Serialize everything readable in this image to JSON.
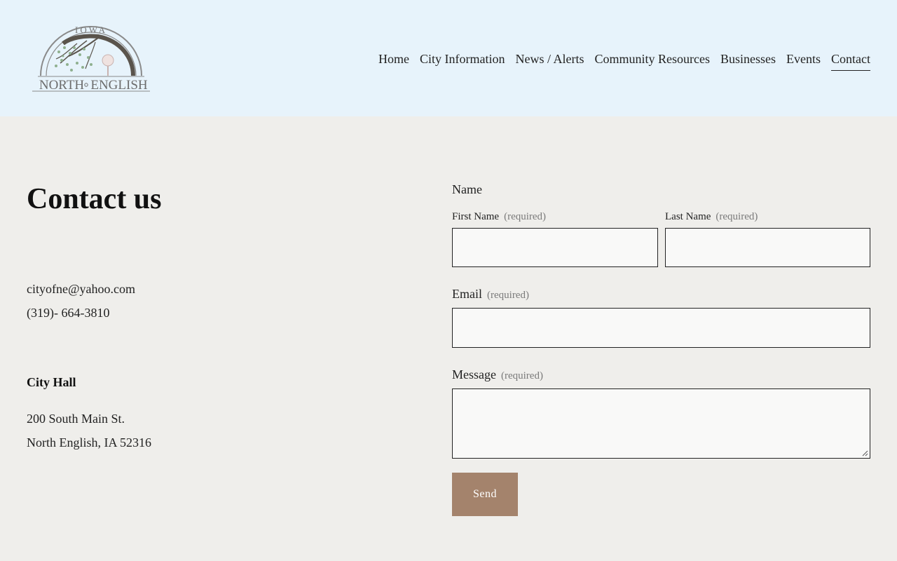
{
  "logo": {
    "top_text": "IOWA",
    "left_text": "NORTH",
    "right_text": "ENGLISH"
  },
  "nav": {
    "items": [
      {
        "label": "Home"
      },
      {
        "label": "City Information"
      },
      {
        "label": "News / Alerts"
      },
      {
        "label": "Community Resources"
      },
      {
        "label": "Businesses"
      },
      {
        "label": "Events"
      },
      {
        "label": "Contact",
        "active": true
      }
    ]
  },
  "contact": {
    "heading": "Contact us",
    "email": "cityofne@yahoo.com",
    "phone": "(319)- 664-3810",
    "hall_title": "City Hall",
    "address_line1": "200 South Main St.",
    "address_line2": "North English, IA 52316"
  },
  "form": {
    "name_label": "Name",
    "first_name_label": "First Name",
    "last_name_label": "Last Name",
    "email_label": "Email",
    "message_label": "Message",
    "required_text": "(required)",
    "first_name_value": "",
    "last_name_value": "",
    "email_value": "",
    "message_value": "",
    "submit_label": "Send"
  },
  "colors": {
    "header_bg": "#e7f3fb",
    "body_bg": "#efeeeb",
    "button_bg": "#a4836c"
  }
}
